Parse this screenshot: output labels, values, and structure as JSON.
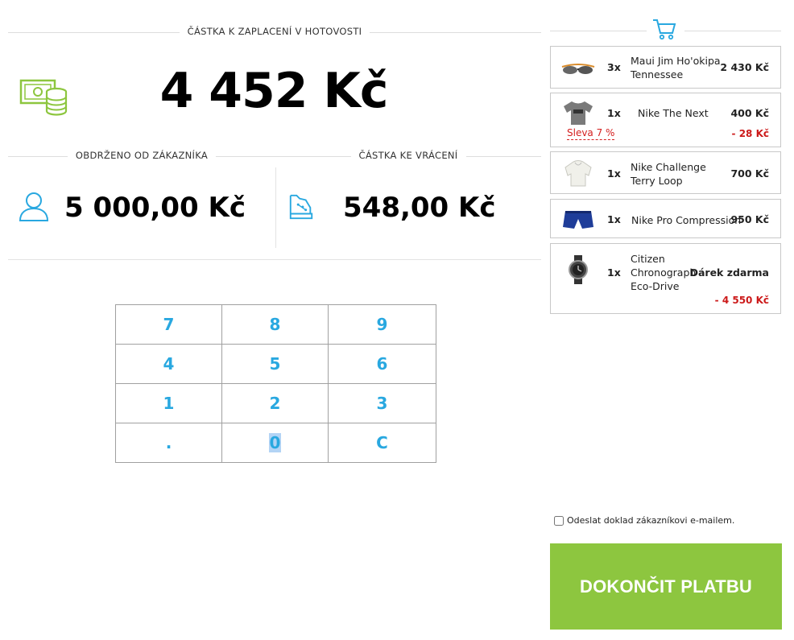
{
  "payment": {
    "heading_due": "ČÁSTKA K ZAPLACENÍ V HOTOVOSTI",
    "total_due": "4 452 Kč",
    "heading_received": "OBDRŽENO OD ZÁKAZNÍKA",
    "received": "5 000,00 Kč",
    "heading_change": "ČÁSTKA KE VRÁCENÍ",
    "change": "548,00 Kč"
  },
  "keypad": {
    "keys": [
      "7",
      "8",
      "9",
      "4",
      "5",
      "6",
      "1",
      "2",
      "3",
      ".",
      "0",
      "C"
    ]
  },
  "cart": {
    "items": [
      {
        "qty": "3x",
        "name": "Maui Jim Ho'okipa Tennessee",
        "price": "2 430 Kč",
        "icon": "sunglasses-icon"
      },
      {
        "qty": "1x",
        "name": "Nike The Next",
        "price": "400 Kč",
        "discount_label": "Sleva 7 %",
        "discount_value": "- 28 Kč",
        "icon": "tshirt-icon"
      },
      {
        "qty": "1x",
        "name": "Nike Challenge Terry Loop",
        "price": "700 Kč",
        "icon": "hoodie-icon"
      },
      {
        "qty": "1x",
        "name": "Nike Pro Compression",
        "price": "950 Kč",
        "icon": "shorts-icon"
      },
      {
        "qty": "1x",
        "name": "Citizen Chronograph Eco-Drive",
        "price": "Dárek zdarma",
        "discount_value": "- 4 550 Kč",
        "icon": "watch-icon"
      }
    ]
  },
  "email_receipt_label": "Odeslat doklad zákazníkovi e-mailem.",
  "finish_label": "DOKONČIT PLATBU",
  "colors": {
    "accent_blue": "#29a8e0",
    "accent_green": "#8dc63f",
    "discount_red": "#cc1a1a"
  }
}
